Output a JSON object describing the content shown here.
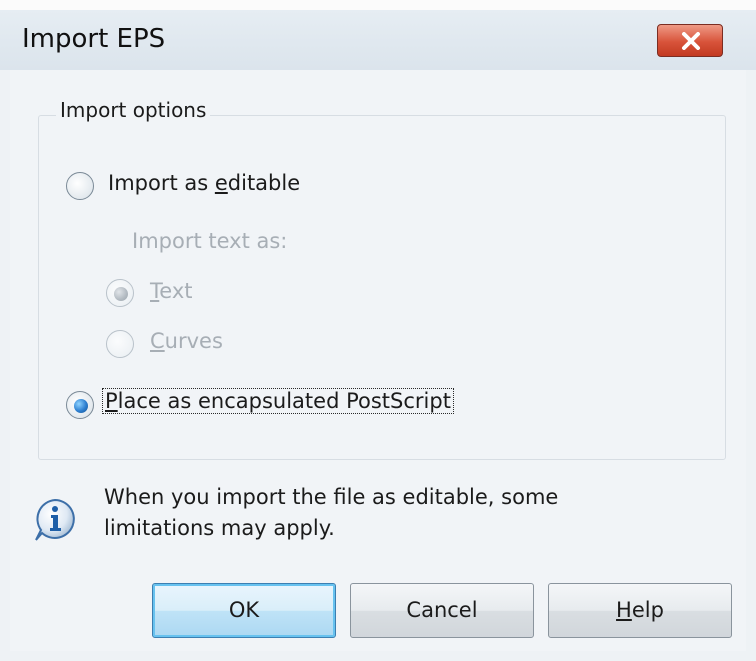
{
  "window": {
    "title": "Import EPS"
  },
  "import_options": {
    "group_label": "Import options",
    "import_as_editable": {
      "pre": "Import as ",
      "accel": "e",
      "post": "ditable",
      "selected": false
    },
    "import_text_as_label": "Import text as:",
    "text_option": {
      "pre": "",
      "accel": "T",
      "post": "ext",
      "selected": true,
      "enabled": false
    },
    "curves_option": {
      "pre": "",
      "accel": "C",
      "post": "urves",
      "selected": false,
      "enabled": false
    },
    "place_as_eps": {
      "pre": "",
      "accel": "P",
      "post": "lace as encapsulated PostScript",
      "selected": true
    }
  },
  "info": {
    "icon": "info-icon",
    "line1": "When you import the file as editable, some",
    "line2": "limitations may apply."
  },
  "buttons": {
    "ok": "OK",
    "cancel": "Cancel",
    "help_pre": "",
    "help_accel": "H",
    "help_post": "elp"
  },
  "colors": {
    "close_button": "#d8533a",
    "selected_radio": "#2d7fd0",
    "disabled_text": "#a7aeb5"
  }
}
